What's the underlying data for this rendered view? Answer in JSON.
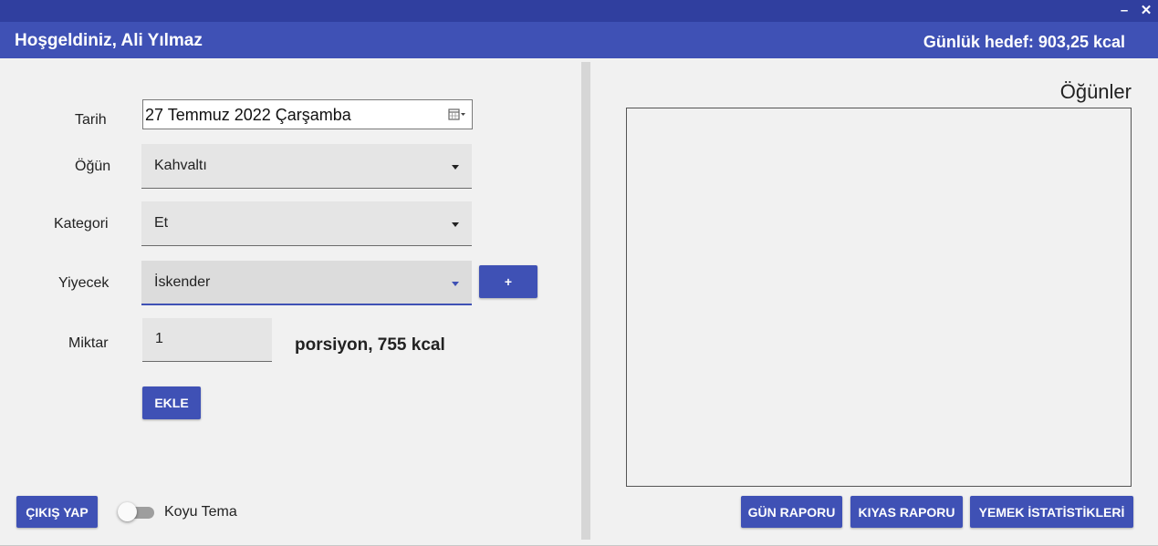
{
  "window": {
    "minimize_label": "–",
    "close_label": "✕"
  },
  "header": {
    "welcome": "Hoşgeldiniz, Ali Yılmaz",
    "daily_goal": "Günlük hedef: 903,25 kcal"
  },
  "form": {
    "date_label": "Tarih",
    "date_value": "27 Temmuz 2022 Çarşamba",
    "date_icon": "calendar-icon",
    "meal_label": "Öğün",
    "meal_value": "Kahvaltı",
    "category_label": "Kategori",
    "category_value": "Et",
    "food_label": "Yiyecek",
    "food_value": "İskender",
    "add_food_button": "+",
    "amount_label": "Miktar",
    "amount_value": "1",
    "portion_text": "porsiyon, 755 kcal",
    "add_button": "EKLE"
  },
  "footer": {
    "logout_button": "ÇIKIŞ YAP",
    "dark_theme_label": "Koyu Tema",
    "dark_theme_on": false
  },
  "meals": {
    "title": "Öğünler",
    "items": []
  },
  "reports": {
    "day_report": "GÜN RAPORU",
    "compare_report": "KIYAS RAPORU",
    "food_stats": "YEMEK İSTATİSTİKLERİ"
  },
  "colors": {
    "primary": "#3f51b5",
    "primary_dark": "#303f9f",
    "background": "#f1f1f1"
  }
}
